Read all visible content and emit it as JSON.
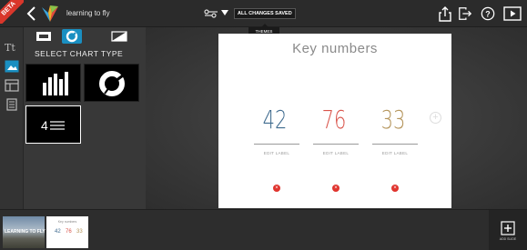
{
  "app": {
    "beta_label": "BETA",
    "title": "learning to fly",
    "save_status": "ALL CHANGES SAVED",
    "themes_tooltip": "THEMES"
  },
  "panel": {
    "heading": "SELECT CHART TYPE",
    "tile_label": "4"
  },
  "slide": {
    "title": "Key numbers",
    "numbers": [
      {
        "value": "42",
        "color": "#3f6b8f",
        "label": "EDIT LABEL"
      },
      {
        "value": "76",
        "color": "#d9534a",
        "label": "EDIT LABEL"
      },
      {
        "value": "33",
        "color": "#b5955c",
        "label": "EDIT LABEL"
      }
    ],
    "delete_symbol": "×",
    "add_symbol": "+"
  },
  "filmstrip": {
    "thumb1_text": "LEARNING TO FLY",
    "thumb2_title": "Key numbers",
    "thumb2_values": [
      "42",
      "76",
      "33"
    ],
    "add_slide_label": "ADD SLIDE"
  },
  "colors": {
    "accent": "#1a8fc1",
    "beta": "#d9372b",
    "delete": "#e0342e"
  },
  "icons": {
    "left_column": [
      "text-icon",
      "image-icon",
      "layout-icon",
      "document-icon"
    ],
    "type_buttons": [
      "photo-type-icon",
      "chart-type-icon",
      "contrast-type-icon"
    ],
    "top_right": [
      "share-icon",
      "exit-icon",
      "help-icon",
      "play-icon"
    ]
  }
}
